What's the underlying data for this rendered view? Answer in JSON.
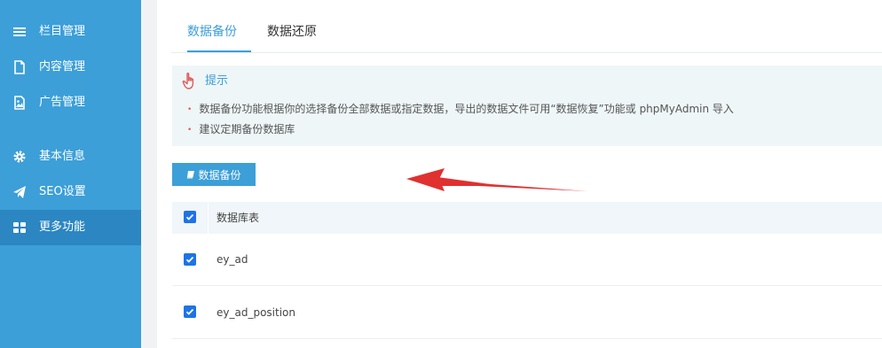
{
  "sidebar": {
    "items": [
      {
        "label": "栏目管理",
        "icon": "menu-lines-icon"
      },
      {
        "label": "内容管理",
        "icon": "document-icon"
      },
      {
        "label": "广告管理",
        "icon": "image-icon"
      },
      {
        "label": "基本信息",
        "icon": "gear-icon"
      },
      {
        "label": "SEO设置",
        "icon": "paper-plane-icon"
      },
      {
        "label": "更多功能",
        "icon": "grid-icon",
        "active": true
      }
    ]
  },
  "tabs": [
    {
      "label": "数据备份",
      "active": true
    },
    {
      "label": "数据还原",
      "active": false
    }
  ],
  "tip": {
    "title": "提示",
    "lines": [
      "数据备份功能根据你的选择备份全部数据或指定数据，导出的数据文件可用“数据恢复”功能或 phpMyAdmin 导入",
      "建议定期备份数据库"
    ]
  },
  "toolbar": {
    "backup_label": "数据备份"
  },
  "table": {
    "header": "数据库表",
    "rows": [
      {
        "name": "ey_ad",
        "checked": true
      },
      {
        "name": "ey_ad_position",
        "checked": true
      }
    ],
    "header_checked": true
  },
  "colors": {
    "sidebar_bg": "#3c9fd8",
    "sidebar_active": "#2b86c2",
    "accent": "#3c9fd8",
    "checkbox": "#1e73e8",
    "arrow": "#e03030"
  }
}
